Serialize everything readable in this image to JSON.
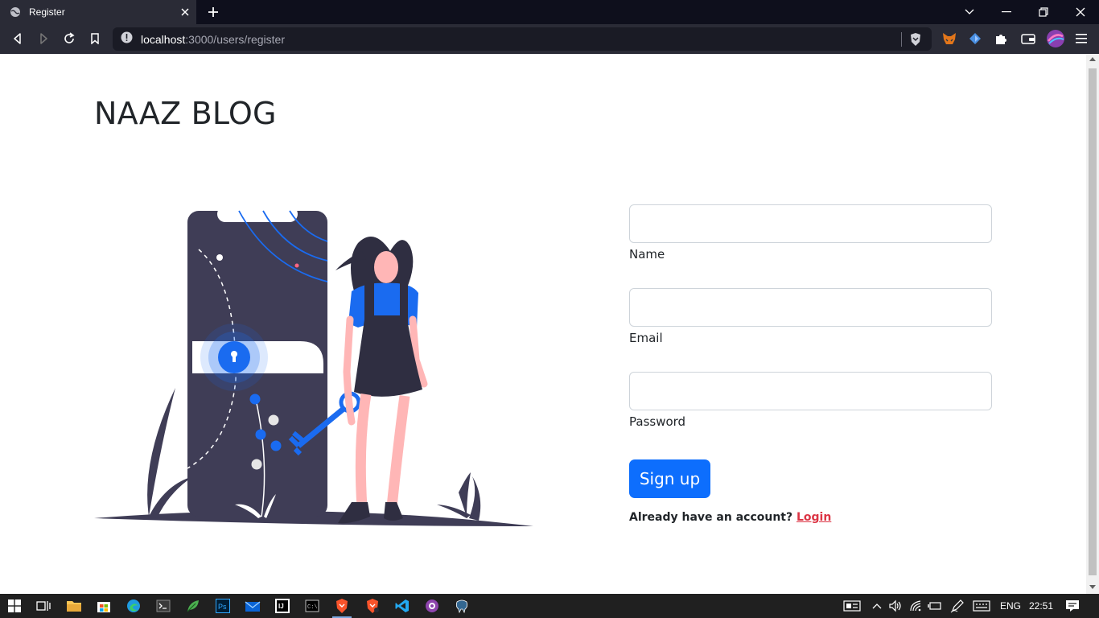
{
  "browser": {
    "tab_title": "Register",
    "url_host": "localhost",
    "url_path": ":3000/users/register"
  },
  "page": {
    "brand": "NAAZ BLOG",
    "form": {
      "name_label": "Name",
      "email_label": "Email",
      "password_label": "Password",
      "name_value": "",
      "email_value": "",
      "password_value": "",
      "submit_label": "Sign up",
      "account_prompt": "Already have an account?",
      "login_link": "Login"
    }
  },
  "taskbar": {
    "language": "ENG",
    "time": "22:51"
  },
  "colors": {
    "primary": "#0d6efd",
    "link": "#dc3545",
    "illustration_dark": "#3f3d56",
    "illustration_accent": "#1a6bf0",
    "skin": "#ffb6b6"
  }
}
